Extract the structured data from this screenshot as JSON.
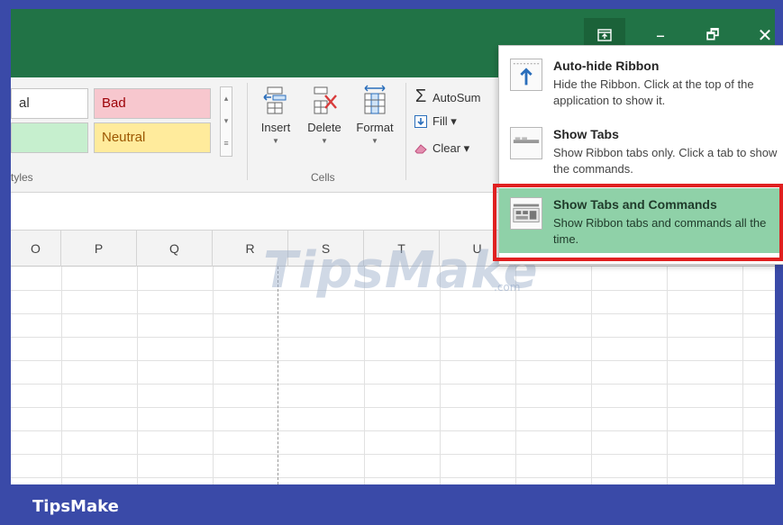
{
  "titlebar": {
    "ribbon_options_icon": "ribbon-display-options-icon",
    "minimize_icon": "–",
    "maximize_icon": "🗗",
    "close_icon": "✕"
  },
  "ribbon": {
    "styles": {
      "normal_label": "al",
      "bad_label": "Bad",
      "good_label": "",
      "neutral_label": "Neutral",
      "group_label": "tyles"
    },
    "cells": {
      "insert_label": "Insert",
      "delete_label": "Delete",
      "format_label": "Format",
      "group_label": "Cells"
    },
    "editing": {
      "autosum_label": "AutoSum",
      "fill_label": "Fill ▾",
      "clear_label": "Clear ▾"
    }
  },
  "grid": {
    "columns": [
      "O",
      "P",
      "Q",
      "R",
      "S",
      "T",
      "U"
    ]
  },
  "menu": {
    "items": [
      {
        "title": "Auto-hide Ribbon",
        "desc": "Hide the Ribbon. Click at the top of the application to show it."
      },
      {
        "title": "Show Tabs",
        "desc": "Show Ribbon tabs only. Click a tab to show the commands."
      },
      {
        "title": "Show Tabs and Commands",
        "desc": "Show Ribbon tabs and commands all the time."
      }
    ]
  },
  "watermark": {
    "text": "TipsMake",
    "suffix": ".com"
  },
  "footer": {
    "label": "TipsMake"
  },
  "colors": {
    "titlebar": "#217346",
    "frame": "#3a4aa8",
    "selected_item": "#8fd1a8",
    "highlight": "#e02020"
  }
}
